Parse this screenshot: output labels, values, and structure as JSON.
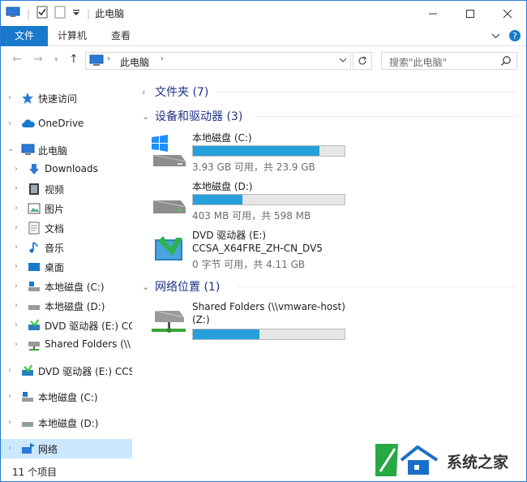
{
  "window": {
    "title": "此电脑"
  },
  "ribbon": {
    "tabs": [
      {
        "label": "文件"
      },
      {
        "label": "计算机"
      },
      {
        "label": "查看"
      }
    ]
  },
  "address": {
    "path_item": "此电脑",
    "search_placeholder": "搜索\"此电脑\""
  },
  "sidebar": {
    "items": [
      {
        "label": "快速访问"
      },
      {
        "label": "OneDrive"
      },
      {
        "label": "此电脑"
      },
      {
        "label": "Downloads"
      },
      {
        "label": "视频"
      },
      {
        "label": "图片"
      },
      {
        "label": "文档"
      },
      {
        "label": "音乐"
      },
      {
        "label": "桌面"
      },
      {
        "label": "本地磁盘 (C:)"
      },
      {
        "label": "本地磁盘 (D:)"
      },
      {
        "label": "DVD 驱动器 (E:) CC"
      },
      {
        "label": "Shared Folders (\\\\"
      },
      {
        "label": "DVD 驱动器 (E:) CCS"
      },
      {
        "label": "本地磁盘 (C:)"
      },
      {
        "label": "本地磁盘 (D:)"
      },
      {
        "label": "网络"
      }
    ]
  },
  "main": {
    "groups": [
      {
        "title": "文件夹 (7)"
      },
      {
        "title": "设备和驱动器 (3)"
      },
      {
        "title": "网络位置 (1)"
      }
    ],
    "drives": [
      {
        "name": "本地磁盘 (C:)",
        "info": "3.93 GB 可用，共 23.9 GB",
        "used_fraction": 0.836
      },
      {
        "name": "本地磁盘 (D:)",
        "info": "403 MB 可用，共 598 MB",
        "used_fraction": 0.326
      },
      {
        "name": "DVD 驱动器 (E:)",
        "label2": "CCSA_X64FRE_ZH-CN_DV5",
        "info": "0 字节 可用，共 4.11 GB"
      },
      {
        "name": "Shared Folders (\\\\vmware-host)",
        "label2": "(Z:)",
        "used_fraction": 0.44
      }
    ]
  },
  "status": {
    "count": "11 个项目"
  },
  "watermark": {
    "text": "系统之家"
  },
  "colors": {
    "accent": "#1979ca",
    "bar_fill": "#26a0da",
    "selected": "#cce8ff",
    "group_title": "#1e3287"
  }
}
